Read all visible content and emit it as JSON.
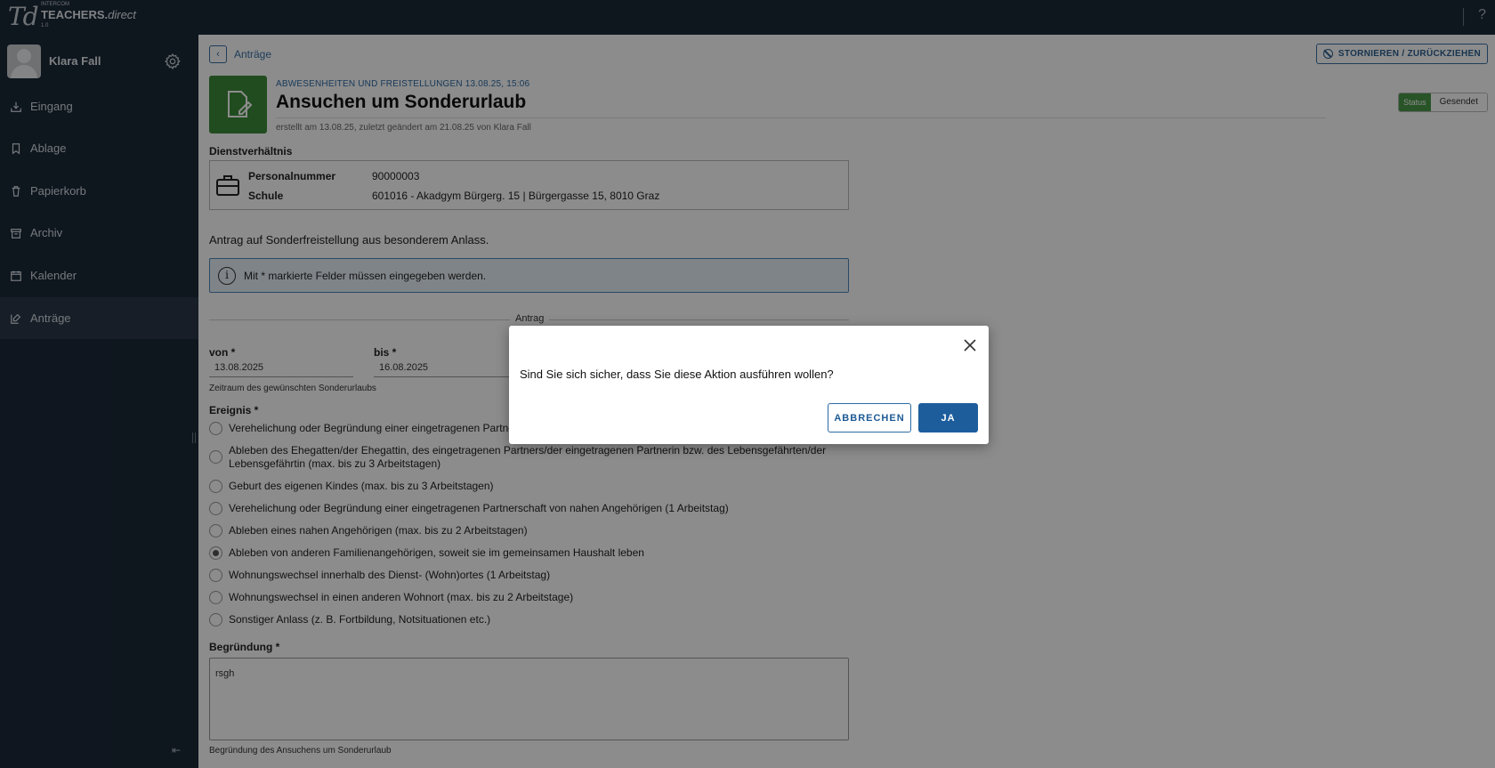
{
  "app": {
    "brand_small": "INTERCOM",
    "brand_name": "TEACHERS.",
    "brand_name_italic": "direct",
    "version": "1.0",
    "logo_text": "Td",
    "help_icon": "?"
  },
  "sidebar": {
    "user_name": "Klara Fall",
    "items": [
      {
        "label": "Eingang",
        "icon": "inbox-icon"
      },
      {
        "label": "Ablage",
        "icon": "bookmark-icon"
      },
      {
        "label": "Papierkorb",
        "icon": "trash-icon"
      },
      {
        "label": "Archiv",
        "icon": "archive-icon"
      },
      {
        "label": "Kalender",
        "icon": "calendar-icon"
      },
      {
        "label": "Anträge",
        "icon": "edit-icon",
        "active": true
      }
    ],
    "collapse_icon": "⇤"
  },
  "header": {
    "back_label": "Anträge",
    "cancel_label": "STORNIEREN / ZURÜCKZIEHEN",
    "subtitle": "ABWESENHEITEN UND FREISTELLUNGEN 13.08.25, 15:06",
    "title": "Ansuchen um Sonderurlaub",
    "meta": "erstellt am 13.08.25, zuletzt geändert am 21.08.25 von Klara Fall",
    "status_label": "Status",
    "status_value": "Gesendet"
  },
  "employment": {
    "heading": "Dienstverhältnis",
    "personalnummer_label": "Personalnummer",
    "personalnummer_value": "90000003",
    "schule_label": "Schule",
    "schule_value": "601016 - Akadgym Bürgerg. 15 | Bürgergasse 15, 8010 Graz"
  },
  "form": {
    "intro": "Antrag auf Sonderfreistellung aus besonderem Anlass.",
    "info": "Mit * markierte Felder müssen eingegeben werden.",
    "section_label": "Antrag",
    "von_label": "von *",
    "von_value": "13.08.2025",
    "bis_label": "bis *",
    "bis_value": "16.08.2025",
    "zeitraum_hint": "Zeitraum des gewünschten Sonderurlaubs",
    "ereignis_label": "Ereignis *",
    "options": [
      {
        "line1": "Verehelichung oder Begründung einer eingetragenen Partnersch",
        "line2": "",
        "checked": false
      },
      {
        "line1": "Ableben des Ehegatten/der Ehegattin, des eingetragenen Partners/der eingetragenen Partnerin bzw. des Lebensgefährten/der",
        "line2": "Lebensgefährtin (max. bis zu 3 Arbeitstagen)",
        "checked": false
      },
      {
        "line1": "Geburt des eigenen Kindes (max. bis zu 3 Arbeitstagen)",
        "line2": "",
        "checked": false
      },
      {
        "line1": "Verehelichung oder Begründung einer eingetragenen Partnerschaft von nahen Angehörigen (1 Arbeitstag)",
        "line2": "",
        "checked": false
      },
      {
        "line1": "Ableben eines nahen Angehörigen (max. bis zu 2 Arbeitstagen)",
        "line2": "",
        "checked": false
      },
      {
        "line1": "Ableben von anderen Familienangehörigen, soweit sie im gemeinsamen Haushalt leben",
        "line2": "",
        "checked": true
      },
      {
        "line1": "Wohnungswechsel innerhalb des Dienst- (Wohn)ortes (1 Arbeitstag)",
        "line2": "",
        "checked": false
      },
      {
        "line1": "Wohnungswechsel in einen anderen Wohnort (max. bis zu 2 Arbeitstage)",
        "line2": "",
        "checked": false
      },
      {
        "line1": "Sonstiger Anlass (z. B. Fortbildung, Notsituationen etc.)",
        "line2": "",
        "checked": false
      }
    ],
    "begruendung_label": "Begründung *",
    "begruendung_value": "rsgh",
    "begruendung_hint": "Begründung des Ansuchens um Sonderurlaub"
  },
  "dialog": {
    "message": "Sind Sie sich sicher, dass Sie diese Aktion ausführen wollen?",
    "cancel_label": "ABBRECHEN",
    "confirm_label": "JA"
  },
  "colors": {
    "sidebar_bg": "#1b2838",
    "accent": "#1d5d9c",
    "success": "#4a9a48"
  }
}
